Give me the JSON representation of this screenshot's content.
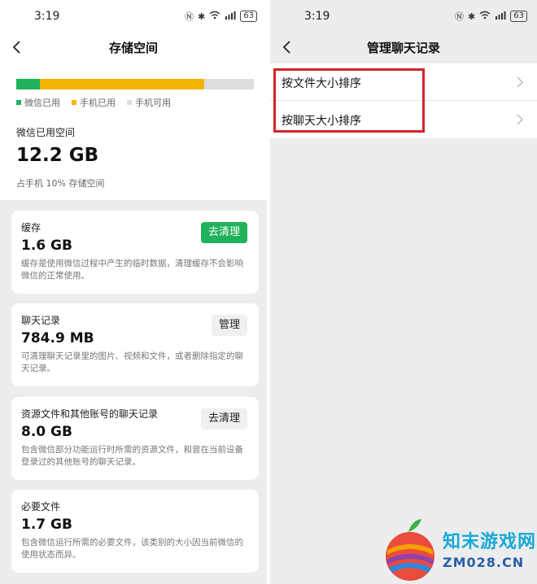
{
  "left": {
    "status": {
      "time": "3:19",
      "battery": "63"
    },
    "title": "存储空间",
    "legend": [
      {
        "label": "微信已用",
        "color": "#20b25a"
      },
      {
        "label": "手机已用",
        "color": "#f5b400"
      },
      {
        "label": "手机可用",
        "color": "#dddddd"
      }
    ],
    "storage_bar": {
      "wechat_used_pct": 10,
      "phone_used_pct": 69,
      "available_pct": 21
    },
    "used_label": "微信已用空间",
    "used_value": "12.2 GB",
    "used_note": "占手机 10% 存储空间",
    "cards": [
      {
        "title": "缓存",
        "value": "1.6 GB",
        "desc": "缓存是使用微信过程中产生的临时数据，清理缓存不会影响微信的正常使用。",
        "button": "去清理"
      },
      {
        "title": "聊天记录",
        "value": "784.9 MB",
        "desc": "可清理聊天记录里的图片、视频和文件，或者删除指定的聊天记录。",
        "button": "管理"
      },
      {
        "title": "资源文件和其他账号的聊天记录",
        "value": "8.0 GB",
        "desc": "包含微信部分功能运行时所需的资源文件，和曾在当前设备登录过的其他账号的聊天记录。",
        "button": "去清理"
      },
      {
        "title": "必要文件",
        "value": "1.7 GB",
        "desc": "包含微信运行所需的必要文件，该类别的大小因当前微信的使用状态而异。"
      }
    ]
  },
  "right": {
    "status": {
      "time": "3:19",
      "battery": "63"
    },
    "title": "管理聊天记录",
    "items": [
      {
        "label": "按文件大小排序"
      },
      {
        "label": "按聊天大小排序"
      }
    ]
  },
  "watermark": {
    "name": "知末游戏网",
    "domain": "ZM028.CN"
  }
}
